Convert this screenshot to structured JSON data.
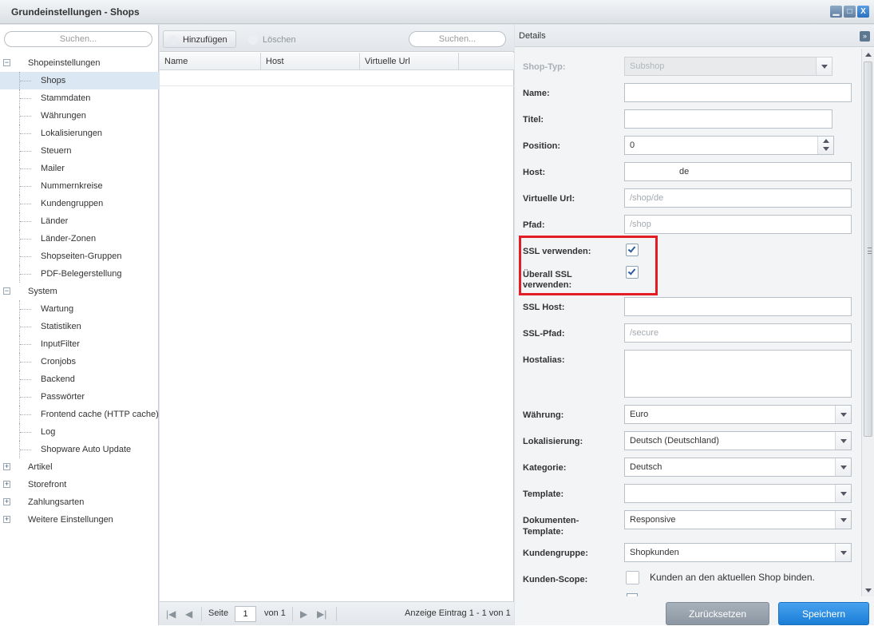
{
  "window": {
    "title": "Grundeinstellungen - Shops",
    "btn_min": "▁",
    "btn_max": "□",
    "btn_close": "X"
  },
  "left": {
    "search_placeholder": "Suchen...",
    "tree": [
      {
        "label": "Shopeinstellungen",
        "level": 0,
        "expander": "−"
      },
      {
        "label": "Shops",
        "level": 1,
        "selected": true
      },
      {
        "label": "Stammdaten",
        "level": 1
      },
      {
        "label": "Währungen",
        "level": 1
      },
      {
        "label": "Lokalisierungen",
        "level": 1
      },
      {
        "label": "Steuern",
        "level": 1
      },
      {
        "label": "Mailer",
        "level": 1
      },
      {
        "label": "Nummernkreise",
        "level": 1
      },
      {
        "label": "Kundengruppen",
        "level": 1
      },
      {
        "label": "Länder",
        "level": 1
      },
      {
        "label": "Länder-Zonen",
        "level": 1
      },
      {
        "label": "Shopseiten-Gruppen",
        "level": 1
      },
      {
        "label": "PDF-Belegerstellung",
        "level": 1
      },
      {
        "label": "System",
        "level": 0,
        "expander": "−"
      },
      {
        "label": "Wartung",
        "level": 1
      },
      {
        "label": "Statistiken",
        "level": 1
      },
      {
        "label": "InputFilter",
        "level": 1
      },
      {
        "label": "Cronjobs",
        "level": 1
      },
      {
        "label": "Backend",
        "level": 1
      },
      {
        "label": "Passwörter",
        "level": 1
      },
      {
        "label": "Frontend cache (HTTP cache)",
        "level": 1
      },
      {
        "label": "Log",
        "level": 1
      },
      {
        "label": "Shopware Auto Update",
        "level": 1
      },
      {
        "label": "Artikel",
        "level": 0,
        "expander": "+"
      },
      {
        "label": "Storefront",
        "level": 0,
        "expander": "+"
      },
      {
        "label": "Zahlungsarten",
        "level": 0,
        "expander": "+"
      },
      {
        "label": "Weitere Einstellungen",
        "level": 0,
        "expander": "+"
      }
    ]
  },
  "grid": {
    "add_label": "Hinzufügen",
    "delete_label": "Löschen",
    "search_placeholder": "Suchen...",
    "columns": [
      "Name",
      "Host",
      "Virtuelle Url"
    ],
    "pager": {
      "page_label": "Seite",
      "page_value": "1",
      "of_label": "von 1",
      "status": "Anzeige Eintrag 1 - 1 von 1",
      "first": "|◀",
      "prev": "◀",
      "next": "▶",
      "last": "▶|"
    }
  },
  "details": {
    "header": "Details",
    "collapse": "»",
    "fields": {
      "shop_type": {
        "label": "Shop-Typ:",
        "value": "Subshop"
      },
      "name": {
        "label": "Name:",
        "value": ""
      },
      "title": {
        "label": "Titel:",
        "value": ""
      },
      "position": {
        "label": "Position:",
        "value": "0"
      },
      "host": {
        "label": "Host:",
        "value": "de"
      },
      "virtual_url": {
        "label": "Virtuelle Url:",
        "placeholder": "/shop/de"
      },
      "path": {
        "label": "Pfad:",
        "placeholder": "/shop"
      },
      "ssl": {
        "label": "SSL verwenden:",
        "checked": true
      },
      "always_ssl": {
        "label1": "Überall SSL",
        "label2": "verwenden:",
        "checked": true
      },
      "ssl_host": {
        "label": "SSL Host:",
        "value": ""
      },
      "ssl_path": {
        "label": "SSL-Pfad:",
        "placeholder": "/secure"
      },
      "hostalias": {
        "label": "Hostalias:",
        "value": ""
      },
      "currency": {
        "label": "Währung:",
        "value": "Euro"
      },
      "locale": {
        "label": "Lokalisierung:",
        "value": "Deutsch (Deutschland)"
      },
      "category": {
        "label": "Kategorie:",
        "value": "Deutsch"
      },
      "template": {
        "label": "Template:",
        "value": ""
      },
      "doc_template": {
        "label1": "Dokumenten-",
        "label2": "Template:",
        "value": "Responsive"
      },
      "customer_group": {
        "label": "Kundengruppe:",
        "value": "Shopkunden"
      },
      "customer_scope": {
        "label": "Kunden-Scope:",
        "text": "Kunden an den aktuellen Shop binden."
      }
    },
    "reset_label": "Zurücksetzen",
    "save_label": "Speichern"
  },
  "colors": {
    "highlight_box": "#e21d24",
    "save_button": "#1a7ed6",
    "selection": "#dbe7f3"
  }
}
